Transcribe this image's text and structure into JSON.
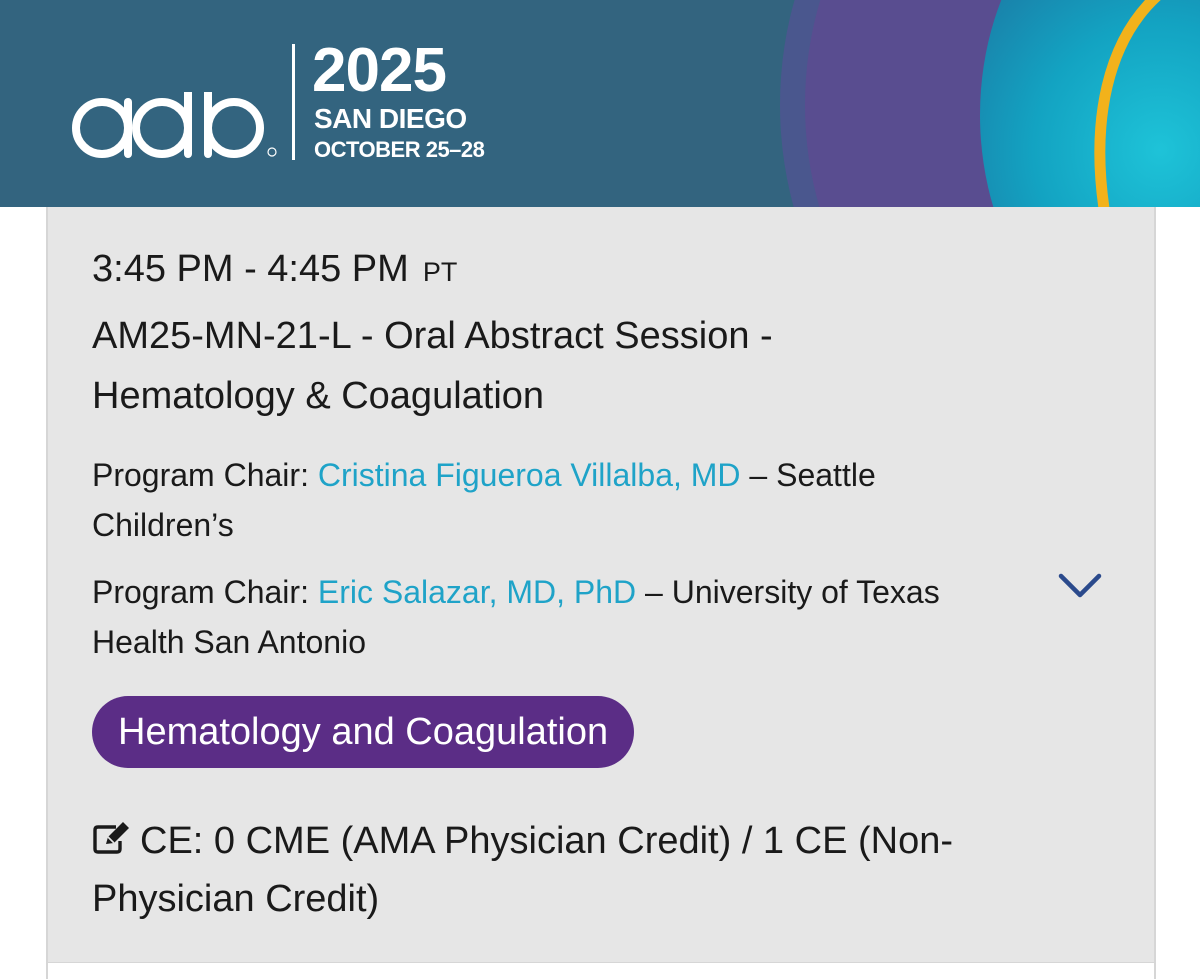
{
  "banner": {
    "logo_text": "adlm",
    "year": "2025",
    "city": "SAN DIEGO",
    "dates": "OCTOBER 25–28",
    "colors": {
      "background": "#33647f",
      "purple": "#5c4c8f",
      "teal": "#1aa3c2",
      "gold": "#f0b31a"
    }
  },
  "session": {
    "time": "3:45 PM - 4:45 PM",
    "timezone": "PT",
    "title": "AM25-MN-21-L - Oral Abstract Session - Hematology & Coagulation",
    "chairs": [
      {
        "label": "Program Chair: ",
        "name": "Cristina Figueroa Villalba, MD",
        "affiliation": " – Seattle Children’s"
      },
      {
        "label": "Program Chair: ",
        "name": "Eric Salazar, MD, PhD",
        "affiliation": " – University of Texas Health San Antonio"
      }
    ],
    "expand_icon": "chevron-down-icon",
    "tag": {
      "label": "Hematology and Coagulation",
      "color": "#5b2d86"
    },
    "ce": {
      "icon": "edit-icon",
      "text": "CE: 0 CME (AMA Physician Credit) / 1 CE (Non-Physician Credit)"
    },
    "link_color": "#1fa3c8"
  }
}
